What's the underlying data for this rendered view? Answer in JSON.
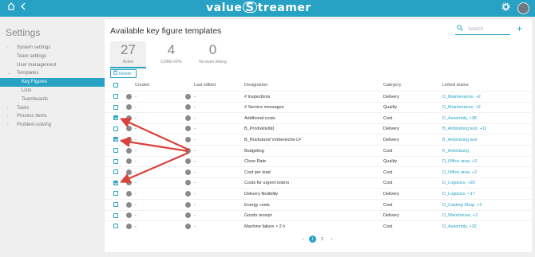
{
  "header": {
    "brand_left": "value",
    "brand_s": "S",
    "brand_right": "treamer",
    "home_icon": "home-icon",
    "back_icon": "chevron-left-icon",
    "settings_icon": "gear-icon",
    "accent": "#27a2c4"
  },
  "sidebar": {
    "heading": "Settings",
    "items": [
      {
        "label": "System settings",
        "chev": "›"
      },
      {
        "label": "Team settings",
        "chev": ""
      },
      {
        "label": "User management",
        "chev": ""
      },
      {
        "label": "Templates",
        "chev": "⌄"
      },
      {
        "label": "Key Figures",
        "chev": ""
      },
      {
        "label": "Lists",
        "chev": ""
      },
      {
        "label": "Teamboards",
        "chev": ""
      },
      {
        "label": "Tasks",
        "chev": "›"
      },
      {
        "label": "Process items",
        "chev": "›"
      },
      {
        "label": "Problem-solving",
        "chev": "›"
      }
    ]
  },
  "main": {
    "title": "Available key figure templates",
    "search_placeholder": "Search",
    "add_label": "+",
    "stats": [
      {
        "num": "27",
        "cap": "Active"
      },
      {
        "num": "4",
        "cap": "CORE-KPIs"
      },
      {
        "num": "0",
        "cap": "No team linking"
      }
    ],
    "delete_label": "Delete",
    "columns": [
      "Creator",
      "Last edited",
      "Designation",
      "Category",
      "Linked teams"
    ],
    "rows": [
      {
        "creator": "-",
        "edited": "-",
        "designation": "# Inspections",
        "category": "Delivery",
        "teams": "D_Maintenance, +2",
        "checked": false
      },
      {
        "creator": "-",
        "edited": "-",
        "designation": "# Service messages",
        "category": "Quality",
        "teams": "D_Maintenance, +2",
        "checked": false
      },
      {
        "creator": "-",
        "edited": "-",
        "designation": "Additional costs",
        "category": "Cost",
        "teams": "D_Assembly, +38",
        "checked": true
      },
      {
        "creator": "-",
        "edited": "-",
        "designation": "B_Produktivität",
        "category": "Delivery",
        "teams": "B_Anbindung test, +11",
        "checked": false
      },
      {
        "creator": "-",
        "edited": "-",
        "designation": "B_Rückstand Vorbereiche LF",
        "category": "Delivery",
        "teams": "B_Anbindung test",
        "checked": true
      },
      {
        "creator": "-",
        "edited": "-",
        "designation": "Budgeting",
        "category": "Cost",
        "teams": "K_Anbindung",
        "checked": false
      },
      {
        "creator": "-",
        "edited": "-",
        "designation": "Close Rate",
        "category": "Quality",
        "teams": "D_Office area, +3",
        "checked": false
      },
      {
        "creator": "-",
        "edited": "-",
        "designation": "Cost per lead",
        "category": "Cost",
        "teams": "D_Office area, +2",
        "checked": false
      },
      {
        "creator": "-",
        "edited": "-",
        "designation": "Costs for urgent orders",
        "category": "Cost",
        "teams": "D_Logistics, +20",
        "checked": true
      },
      {
        "creator": "-",
        "edited": "-",
        "designation": "Delivery flexibility",
        "category": "Delivery",
        "teams": "D_Logistics, +17",
        "checked": false
      },
      {
        "creator": "-",
        "edited": "-",
        "designation": "Energy costs",
        "category": "Cost",
        "teams": "D_Casting Shop, +2",
        "checked": false
      },
      {
        "creator": "-",
        "edited": "-",
        "designation": "Goods receipt",
        "category": "Delivery",
        "teams": "D_Warehouse, +2",
        "checked": false
      },
      {
        "creator": "-",
        "edited": "-",
        "designation": "Machine failure > 2 h",
        "category": "Cost",
        "teams": "D_Assembly, +32",
        "checked": false
      }
    ],
    "pager": {
      "prev": "‹",
      "pages": [
        "1",
        "2"
      ],
      "current": "1",
      "next": "›"
    }
  }
}
